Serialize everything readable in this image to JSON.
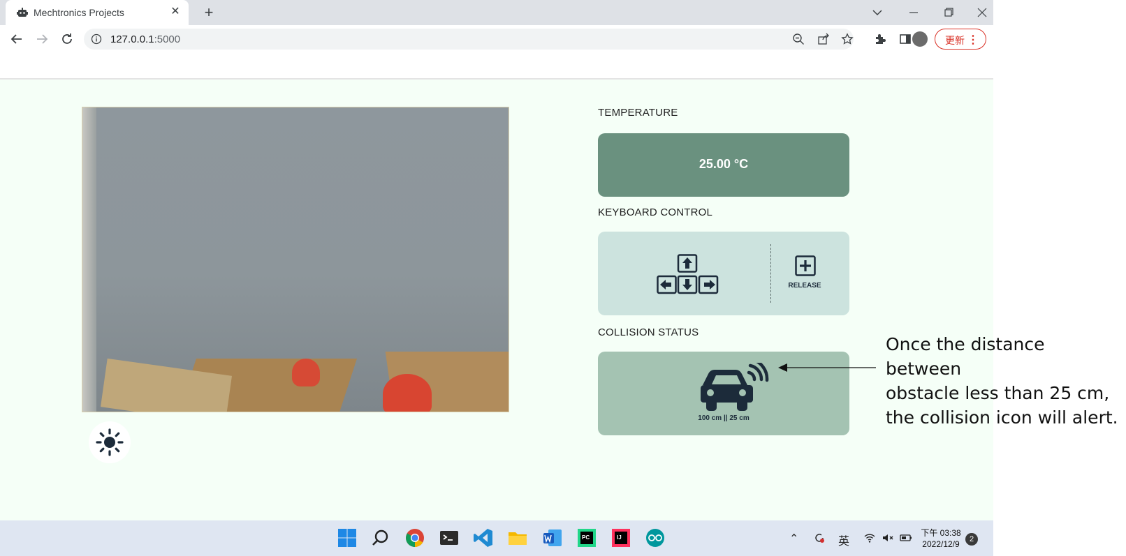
{
  "browser": {
    "tab_title": "Mechtronics Projects",
    "url_host": "127.0.0.1",
    "url_port": ":5000",
    "update_label": "更新"
  },
  "page": {
    "temperature_label": "TEMPERATURE",
    "temperature_value": "25.00 °C",
    "keyboard_label": "KEYBOARD CONTROL",
    "release_label": "RELEASE",
    "collision_label": "COLLISION STATUS",
    "collision_text": "100 cm || 25 cm",
    "colors": {
      "background": "#f5fff7",
      "temp_card": "#6a917f",
      "keyboard_card": "#cce3de",
      "collision_card": "#a4c3b2",
      "icon": "#1c2b3a"
    }
  },
  "annotation": {
    "line1": "Once the distance between",
    "line2": "obstacle less than 25 cm,",
    "line3": "the collision icon will alert."
  },
  "taskbar": {
    "time": "下午 03:38",
    "date": "2022/12/9",
    "notification_count": "2",
    "ime": "英",
    "apps": [
      "windows-start-icon",
      "search-icon",
      "chrome-icon",
      "terminal-icon",
      "vscode-icon",
      "file-explorer-icon",
      "word-icon",
      "pycharm-icon",
      "intellij-icon",
      "arduino-icon"
    ]
  }
}
